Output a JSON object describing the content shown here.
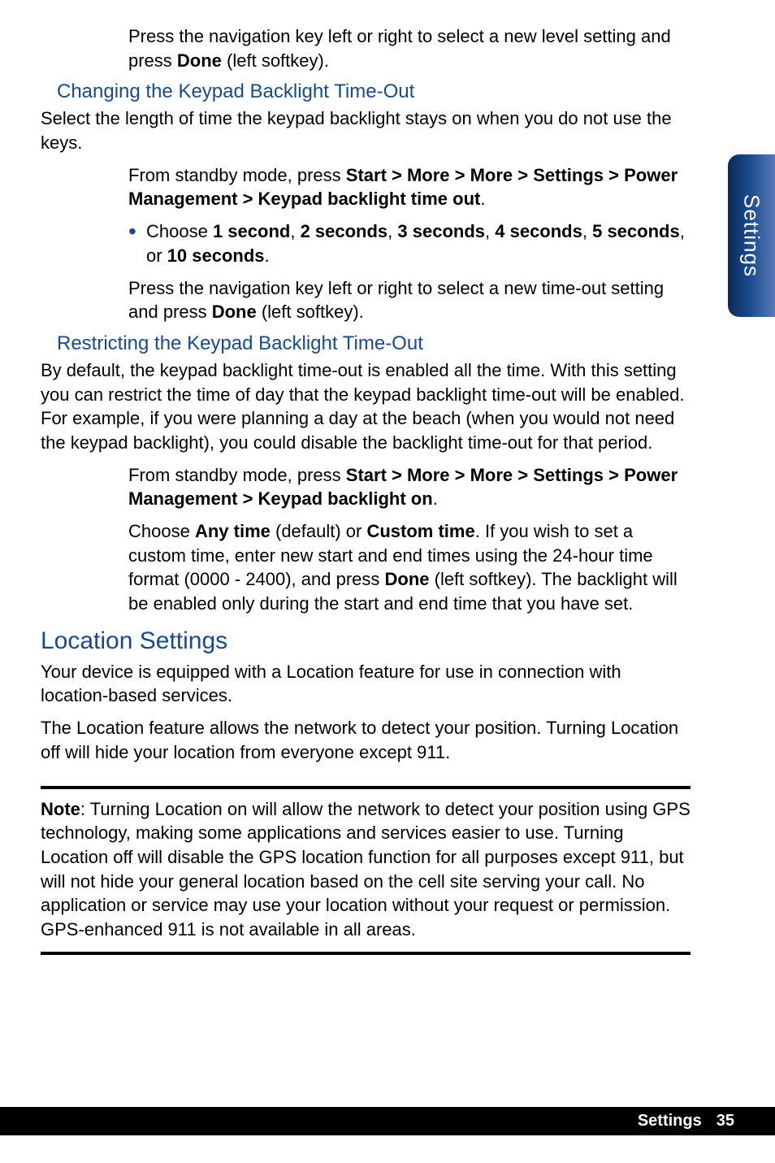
{
  "sideTab": "Settings",
  "p1a": "Press the navigation key left or right to select a new level setting and press ",
  "p1b": "Done",
  "p1c": " (left softkey).",
  "h3_1": "Changing the Keypad Backlight Time-Out",
  "p2": "Select the length of time the keypad backlight stays on when you do not use the keys.",
  "p3a": "From standby mode, press ",
  "p3b": "Start > More > More > Settings > Power Management > Keypad backlight time out",
  "p3c": ".",
  "b1a": "Choose ",
  "b1_1": "1 second",
  "b1_sep": ", ",
  "b1_2": "2 seconds",
  "b1_3": "3 seconds",
  "b1_4": "4 seconds",
  "b1_5": "5 seconds",
  "b1_or": ", or ",
  "b1_6": "10 seconds",
  "b1_end": ".",
  "p4a": "Press the navigation key left or right to select a new time-out setting and press ",
  "p4b": "Done",
  "p4c": " (left softkey).",
  "h3_2": "Restricting the Keypad Backlight Time-Out",
  "p5": "By default, the keypad backlight time-out is enabled all the time. With this setting you can restrict the time of day that the keypad backlight time-out will be enabled. For example, if you were planning a day at the beach (when you would not need the keypad backlight), you could disable the backlight time-out for that period.",
  "p6a": "From standby mode, press ",
  "p6b": "Start > More > More > Settings > Power Management > Keypad backlight on",
  "p6c": ".",
  "p7a": "Choose ",
  "p7b": "Any time",
  "p7c": " (default) or ",
  "p7d": "Custom time",
  "p7e": ". If you wish to set a custom time, enter new start and end times using the 24-hour time format (0000 - 2400), and press ",
  "p7f": "Done",
  "p7g": " (left softkey). The backlight will be enabled only during the start and end time that you have set.",
  "h2_1": "Location Settings",
  "p8": "Your device is equipped with a Location feature for use in connection with location-based services.",
  "p9": "The Location feature allows the network to detect your position. Turning Location off will hide your location from everyone except 911.",
  "noteLabel": "Note",
  "noteText": ": Turning Location on will allow the network to detect your position using GPS technology, making some applications and services easier to use. Turning Location off will disable the GPS location function for all purposes except 911, but will not hide your general location based on the cell site serving your call. No application or service may use your location without your request or permission. GPS-enhanced 911 is not available in all areas.",
  "footerSection": "Settings",
  "footerPage": "35"
}
